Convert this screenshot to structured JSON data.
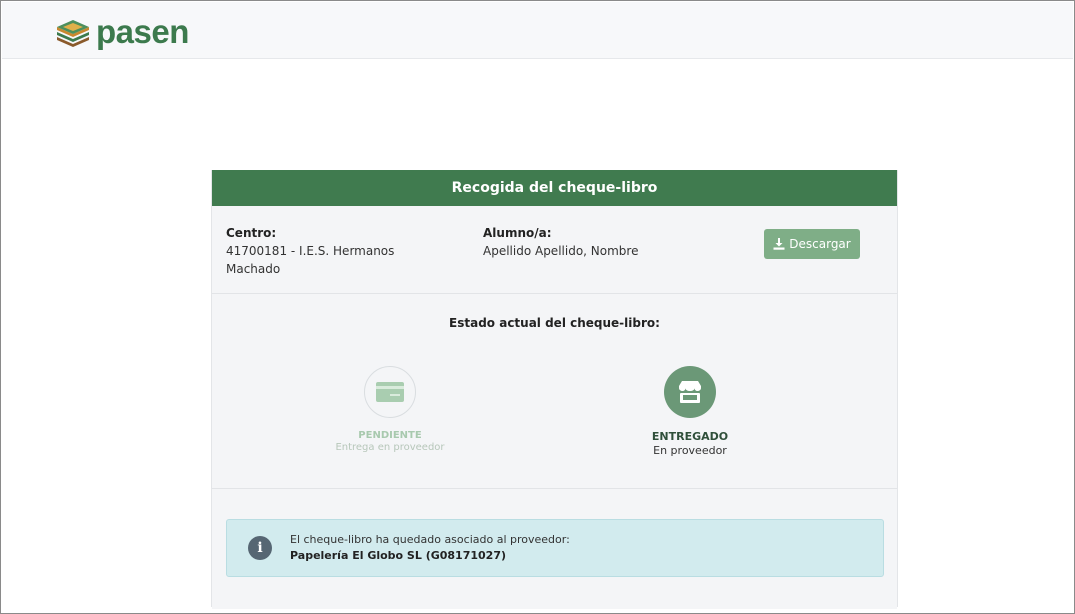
{
  "brand": {
    "name": "pasen"
  },
  "card": {
    "title": "Recogida del cheque-libro",
    "centro": {
      "label": "Centro:",
      "value": "41700181 - I.E.S. Hermanos Machado"
    },
    "alumno": {
      "label": "Alumno/a:",
      "value": "Apellido Apellido, Nombre"
    },
    "download_label": "Descargar",
    "status": {
      "title": "Estado actual del cheque-libro:",
      "steps": [
        {
          "state": "PENDIENTE",
          "sub": "Entrega en proveedor",
          "icon": "credit-card-icon",
          "active": false
        },
        {
          "state": "ENTREGADO",
          "sub": "En proveedor",
          "icon": "store-icon",
          "active": true
        }
      ]
    },
    "alert": {
      "message": "El cheque-libro ha quedado asociado al proveedor:",
      "provider": "Papelería El Globo SL (G08171027)"
    }
  },
  "colors": {
    "brand_green": "#3c7a4d",
    "header_green": "#407b4f",
    "button_green": "#7fae87",
    "active_step": "#6b9877",
    "info_bg": "#d2ebee"
  }
}
